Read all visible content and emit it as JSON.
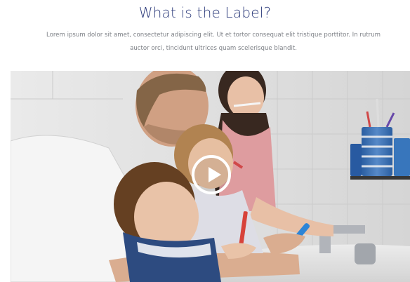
{
  "section": {
    "title": "What is the Label?",
    "intro": "Lorem ipsum dolor sit amet, consectetur adipiscing elit. Ut et tortor consequat elit tristique porttitor. In rutrum auctor orci, tincidunt ultrices quam scelerisque blandit."
  },
  "video": {
    "play_icon": "play-icon",
    "scene": "family-brushing-teeth-photo"
  },
  "colors": {
    "title": "#2b3a7a",
    "body_text": "#7d8086",
    "play_ring": "#ffffff"
  }
}
